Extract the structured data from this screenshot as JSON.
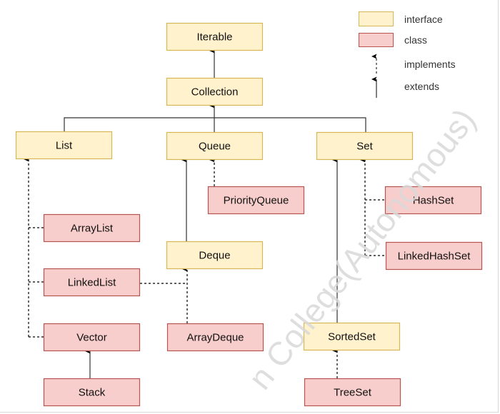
{
  "nodes": [
    {
      "id": "iterable",
      "label": "Iterable",
      "kind": "interface"
    },
    {
      "id": "collection",
      "label": "Collection",
      "kind": "interface"
    },
    {
      "id": "list",
      "label": "List",
      "kind": "interface"
    },
    {
      "id": "queue",
      "label": "Queue",
      "kind": "interface"
    },
    {
      "id": "set",
      "label": "Set",
      "kind": "interface"
    },
    {
      "id": "priorityqueue",
      "label": "PriorityQueue",
      "kind": "class"
    },
    {
      "id": "hashset",
      "label": "HashSet",
      "kind": "class"
    },
    {
      "id": "arraylist",
      "label": "ArrayList",
      "kind": "class"
    },
    {
      "id": "deque",
      "label": "Deque",
      "kind": "interface"
    },
    {
      "id": "linkedhashset",
      "label": "LinkedHashSet",
      "kind": "class"
    },
    {
      "id": "linkedlist",
      "label": "LinkedList",
      "kind": "class"
    },
    {
      "id": "vector",
      "label": "Vector",
      "kind": "class"
    },
    {
      "id": "arraydeque",
      "label": "ArrayDeque",
      "kind": "class"
    },
    {
      "id": "sortedset",
      "label": "SortedSet",
      "kind": "interface"
    },
    {
      "id": "stack",
      "label": "Stack",
      "kind": "class"
    },
    {
      "id": "treeset",
      "label": "TreeSet",
      "kind": "class"
    }
  ],
  "edges": [
    {
      "from": "collection",
      "to": "iterable",
      "type": "extends"
    },
    {
      "from": "list",
      "to": "collection",
      "type": "extends"
    },
    {
      "from": "queue",
      "to": "collection",
      "type": "extends"
    },
    {
      "from": "set",
      "to": "collection",
      "type": "extends"
    },
    {
      "from": "arraylist",
      "to": "list",
      "type": "implements"
    },
    {
      "from": "linkedlist",
      "to": "list",
      "type": "implements"
    },
    {
      "from": "vector",
      "to": "list",
      "type": "implements"
    },
    {
      "from": "priorityqueue",
      "to": "queue",
      "type": "implements"
    },
    {
      "from": "deque",
      "to": "queue",
      "type": "extends"
    },
    {
      "from": "arraydeque",
      "to": "deque",
      "type": "implements"
    },
    {
      "from": "linkedlist",
      "to": "deque",
      "type": "implements"
    },
    {
      "from": "hashset",
      "to": "set",
      "type": "implements"
    },
    {
      "from": "linkedhashset",
      "to": "set",
      "type": "implements"
    },
    {
      "from": "sortedset",
      "to": "set",
      "type": "extends"
    },
    {
      "from": "treeset",
      "to": "sortedset",
      "type": "implements"
    },
    {
      "from": "stack",
      "to": "vector",
      "type": "extends"
    }
  ],
  "legend": {
    "interface": "interface",
    "class": "class",
    "implements": "implements",
    "extends": "extends"
  },
  "colors": {
    "interface_fill": "#fff2cc",
    "interface_stroke": "#d6b656",
    "class_fill": "#f8cecc",
    "class_stroke": "#b85450",
    "line": "#000000",
    "watermark": "#d9d9d9"
  },
  "watermark": "n College(Autonomous)"
}
